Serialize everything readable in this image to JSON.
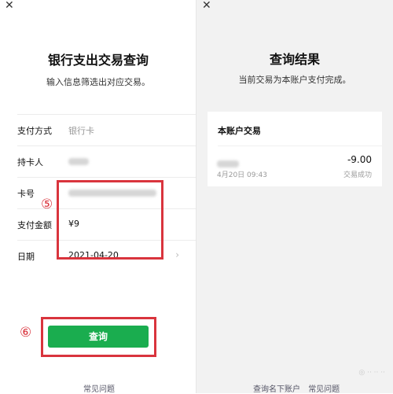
{
  "left": {
    "close_icon": "close-icon",
    "title": "银行支出交易查询",
    "subtitle": "输入信息筛选出对应交易。",
    "fields": [
      {
        "label": "支付方式",
        "value": "银行卡"
      },
      {
        "label": "持卡人",
        "value": ""
      },
      {
        "label": "卡号",
        "value": ""
      },
      {
        "label": "支付金额",
        "value": "¥9"
      },
      {
        "label": "日期",
        "value": "2021-04-20"
      }
    ],
    "annotation_5": "⑤",
    "annotation_6": "⑥",
    "query_button": "查询",
    "faq_link": "常见问题"
  },
  "right": {
    "close_icon": "close-icon",
    "title": "查询结果",
    "subtitle": "当前交易为本账户支付完成。",
    "card": {
      "title": "本账户交易",
      "amount": "-9.00",
      "date": "4月20日 09:43",
      "status": "交易成功"
    },
    "links": [
      "查询名下账户",
      "常见问题"
    ]
  },
  "colors": {
    "primary_green": "#1aad4f",
    "annotation_red": "#d9343d"
  }
}
